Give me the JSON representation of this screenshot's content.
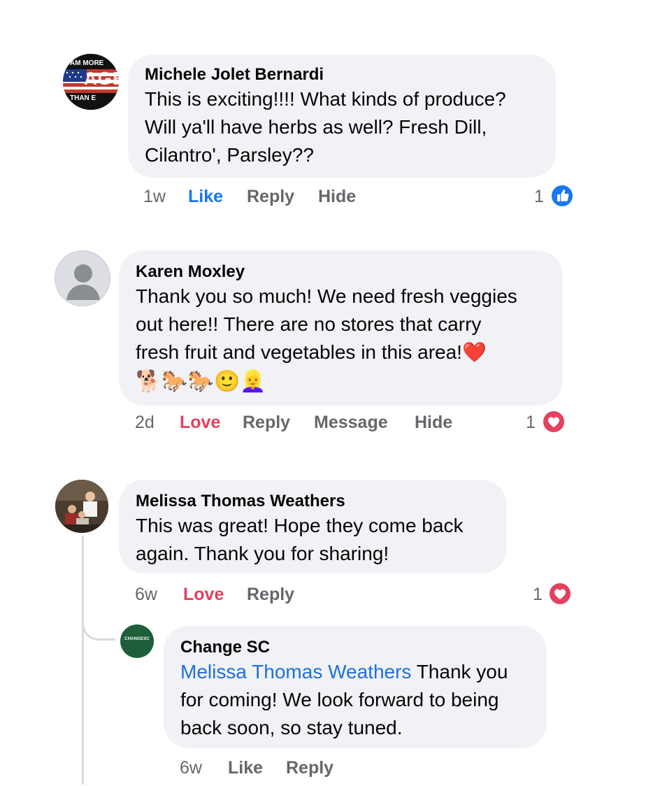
{
  "comments": [
    {
      "author": "Michele Jolet Bernardi",
      "text_lines": [
        "This is exciting!!!! What kinds of produce?",
        "Will ya'll have herbs as well? Fresh Dill,",
        "Cilantro', Parsley??"
      ],
      "time": "1w",
      "reaction_label": "Like",
      "actions": [
        "Reply",
        "Hide"
      ],
      "reaction_count": "1",
      "reaction_icon": "like-icon",
      "avatar_text": [
        "AM MORE",
        "AGE",
        "THAN E"
      ]
    },
    {
      "author": "Karen Moxley",
      "text_lines": [
        "Thank you so much! We need fresh veggies",
        "out here!! There are no stores that carry",
        "fresh fruit and vegetables in this area!"
      ],
      "heart_emoji": "❤️",
      "emoji_row": "🐕🐎🐎🙂👱‍♀️",
      "time": "2d",
      "reaction_label": "Love",
      "actions": [
        "Reply",
        "Message",
        "Hide"
      ],
      "reaction_count": "1",
      "reaction_icon": "love-icon"
    },
    {
      "author": "Melissa Thomas Weathers",
      "text_lines": [
        "This was great! Hope they come back",
        "again. Thank you for sharing!"
      ],
      "time": "6w",
      "reaction_label": "Love",
      "actions": [
        "Reply"
      ],
      "reaction_count": "1",
      "reaction_icon": "love-icon"
    }
  ],
  "reply": {
    "author": "Change SC",
    "avatar_text": "CHANGESC",
    "mention": "Melissa Thomas Weathers",
    "text_first": " Thank you",
    "text_lines": [
      "for coming! We look forward to being",
      "back soon, so stay tuned."
    ],
    "time": "6w",
    "actions": [
      "Like",
      "Reply"
    ]
  },
  "colors": {
    "bubble": "#f0f2f5",
    "like_blue": "#1877f2",
    "love_red": "#e4405f",
    "meta_gray": "#65676b",
    "mention_blue": "#216fdb"
  }
}
